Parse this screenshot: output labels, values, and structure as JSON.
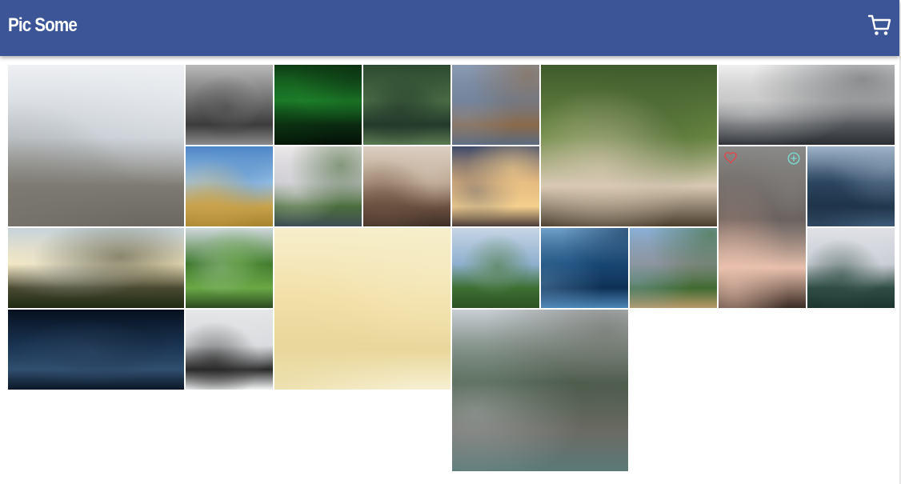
{
  "header": {
    "title": "Pic Some",
    "cart_icon": "cart-icon",
    "background": "#3c5597"
  },
  "photos": [
    {
      "name": "photo-bear",
      "size": "big",
      "colors": [
        "#eef0f3",
        "#c8ced4",
        "#7d7a72",
        "#6a6761"
      ]
    },
    {
      "name": "photo-misty-forest-bw",
      "size": "normal",
      "colors": [
        "#b9b9b9",
        "#6e6e6e",
        "#3c3c3c",
        "#8a8a8a"
      ]
    },
    {
      "name": "photo-aurora",
      "size": "normal",
      "colors": [
        "#0e3d14",
        "#1f8a2d",
        "#0a2a10",
        "#041206"
      ]
    },
    {
      "name": "photo-pine-trees",
      "size": "normal",
      "colors": [
        "#2d4a30",
        "#496b45",
        "#23392a",
        "#5b7a52"
      ]
    },
    {
      "name": "photo-eagle",
      "size": "normal",
      "colors": [
        "#8a9bb3",
        "#6d7e96",
        "#8b6a4a",
        "#5a6b80"
      ]
    },
    {
      "name": "photo-pug-blanket",
      "size": "big",
      "colors": [
        "#3f5a2c",
        "#6c8a44",
        "#d9c9b4",
        "#4a3e2e"
      ]
    },
    {
      "name": "photo-skyscraper",
      "size": "wide",
      "colors": [
        "#f0f0f0",
        "#bdbdbd",
        "#55585c",
        "#2b2e33"
      ]
    },
    {
      "name": "photo-wheat-field-feet",
      "size": "normal",
      "colors": [
        "#4d86c6",
        "#9cc4e6",
        "#c9a24a",
        "#a8842f"
      ]
    },
    {
      "name": "photo-city-park",
      "size": "normal",
      "colors": [
        "#ece8ea",
        "#c9c9cf",
        "#4b6e3c",
        "#3f4d55"
      ]
    },
    {
      "name": "photo-dead-trees",
      "size": "normal",
      "colors": [
        "#ddd0c3",
        "#b59f88",
        "#6a5040",
        "#3e2f26"
      ]
    },
    {
      "name": "photo-railway-sunset",
      "size": "normal",
      "colors": [
        "#3e4a6a",
        "#e0b27a",
        "#f4d08e",
        "#4a3c3a"
      ]
    },
    {
      "name": "photo-woman-portrait",
      "size": "tall",
      "liked": true,
      "colors": [
        "#8a8a88",
        "#5f5552",
        "#e9c1ad",
        "#3a2b24"
      ]
    },
    {
      "name": "photo-mountain-sunset",
      "size": "wide",
      "colors": [
        "#c6d2da",
        "#f7e9c2",
        "#4a4a32",
        "#1f2a12"
      ]
    },
    {
      "name": "photo-ocean-waves",
      "size": "normal",
      "colors": [
        "#9fb3c9",
        "#2f4a66",
        "#1f344a",
        "#3e5b78"
      ]
    },
    {
      "name": "photo-waterfall",
      "size": "normal",
      "colors": [
        "#cfd8dc",
        "#3f7a2e",
        "#6aa845",
        "#2c4a22"
      ]
    },
    {
      "name": "photo-dreamcatcher",
      "size": "big",
      "colors": [
        "#f6eecb",
        "#f3e1a9",
        "#e8d79a",
        "#f7efd1"
      ]
    },
    {
      "name": "photo-castle",
      "size": "normal",
      "colors": [
        "#c6d5e4",
        "#8fb0cf",
        "#3d6f32",
        "#2c5224"
      ]
    },
    {
      "name": "photo-blue-wave",
      "size": "normal",
      "colors": [
        "#6fa0c8",
        "#1a4c7a",
        "#0f3055",
        "#4d86b5"
      ]
    },
    {
      "name": "photo-star-trails",
      "size": "wide",
      "colors": [
        "#06101e",
        "#1a3452",
        "#304e6e",
        "#0a1626"
      ]
    },
    {
      "name": "photo-valley-cliffs",
      "size": "normal",
      "colors": [
        "#8ab0d8",
        "#8c8f93",
        "#3f6a2f",
        "#b89a6a"
      ]
    },
    {
      "name": "photo-foggy-mountain",
      "size": "normal",
      "colors": [
        "#dfe1e6",
        "#c8ccd3",
        "#2f4d44",
        "#1d342f"
      ]
    },
    {
      "name": "photo-river-forest",
      "size": "big",
      "colors": [
        "#c8cfd4",
        "#425843",
        "#6b6a64",
        "#5b7a78"
      ]
    },
    {
      "name": "photo-black-rock-beach",
      "size": "normal",
      "colors": [
        "#e5e6e8",
        "#d7d9dc",
        "#2a2a2a",
        "#f3f4f5"
      ]
    }
  ]
}
